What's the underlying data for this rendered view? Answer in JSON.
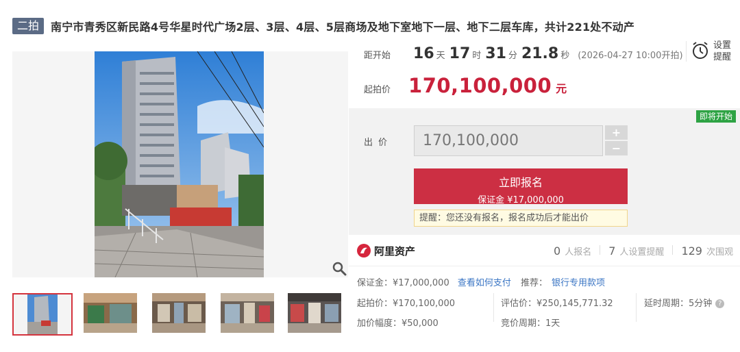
{
  "title": {
    "round_badge": "二拍",
    "text": "南宁市青秀区新民路4号华星时代广场2层、3层、4层、5层商场及地下室地下一层、地下二层车库，共计221处不动产"
  },
  "countdown": {
    "label": "距开始",
    "days": "16",
    "days_unit": "天",
    "hours": "17",
    "hours_unit": "时",
    "minutes": "31",
    "minutes_unit": "分",
    "seconds": "21.8",
    "seconds_unit": "秒",
    "start_time": "(2026-04-27 10:00开拍)"
  },
  "reminder": {
    "label": "设置提醒",
    "icon": "alarm-clock-icon"
  },
  "start_price": {
    "label": "起拍价",
    "value": "170,100,000",
    "unit": "元"
  },
  "bid": {
    "status_tag": "即将开始",
    "label": "出价",
    "input_value": "170,100,000",
    "plus": "+",
    "minus": "−",
    "register_button": "立即报名",
    "deposit_line": "保证金 ¥17,000,000",
    "hint": "提醒：您还没有报名，报名成功后才能出价"
  },
  "brand": {
    "name": "阿里资产",
    "icon": "ali-asset-logo"
  },
  "stats": {
    "signups": "0",
    "signups_label": "人报名",
    "reminders": "7",
    "reminders_label": "人设置提醒",
    "views": "129",
    "views_label": "次围观"
  },
  "details": {
    "deposit_label": "保证金：",
    "deposit_value": "¥17,000,000",
    "how_to_pay": "查看如何支付",
    "recommend_label": "推荐：",
    "recommend_link": "银行专用款项",
    "start_price_label": "起拍价：",
    "start_price_value": "¥170,100,000",
    "appraisal_label": "评估价：",
    "appraisal_value": "¥250,145,771.32",
    "delay_label": "延时周期：",
    "delay_value": "5分钟",
    "increment_label": "加价幅度：",
    "increment_value": "¥50,000",
    "auction_period_label": "竞价周期：",
    "auction_period_value": "1天"
  },
  "colors": {
    "price_red": "#c9213b",
    "button_red": "#cc2f43",
    "tag_green": "#2ea344",
    "link_blue": "#3a75c4",
    "badge_slate": "#5b6b85"
  }
}
